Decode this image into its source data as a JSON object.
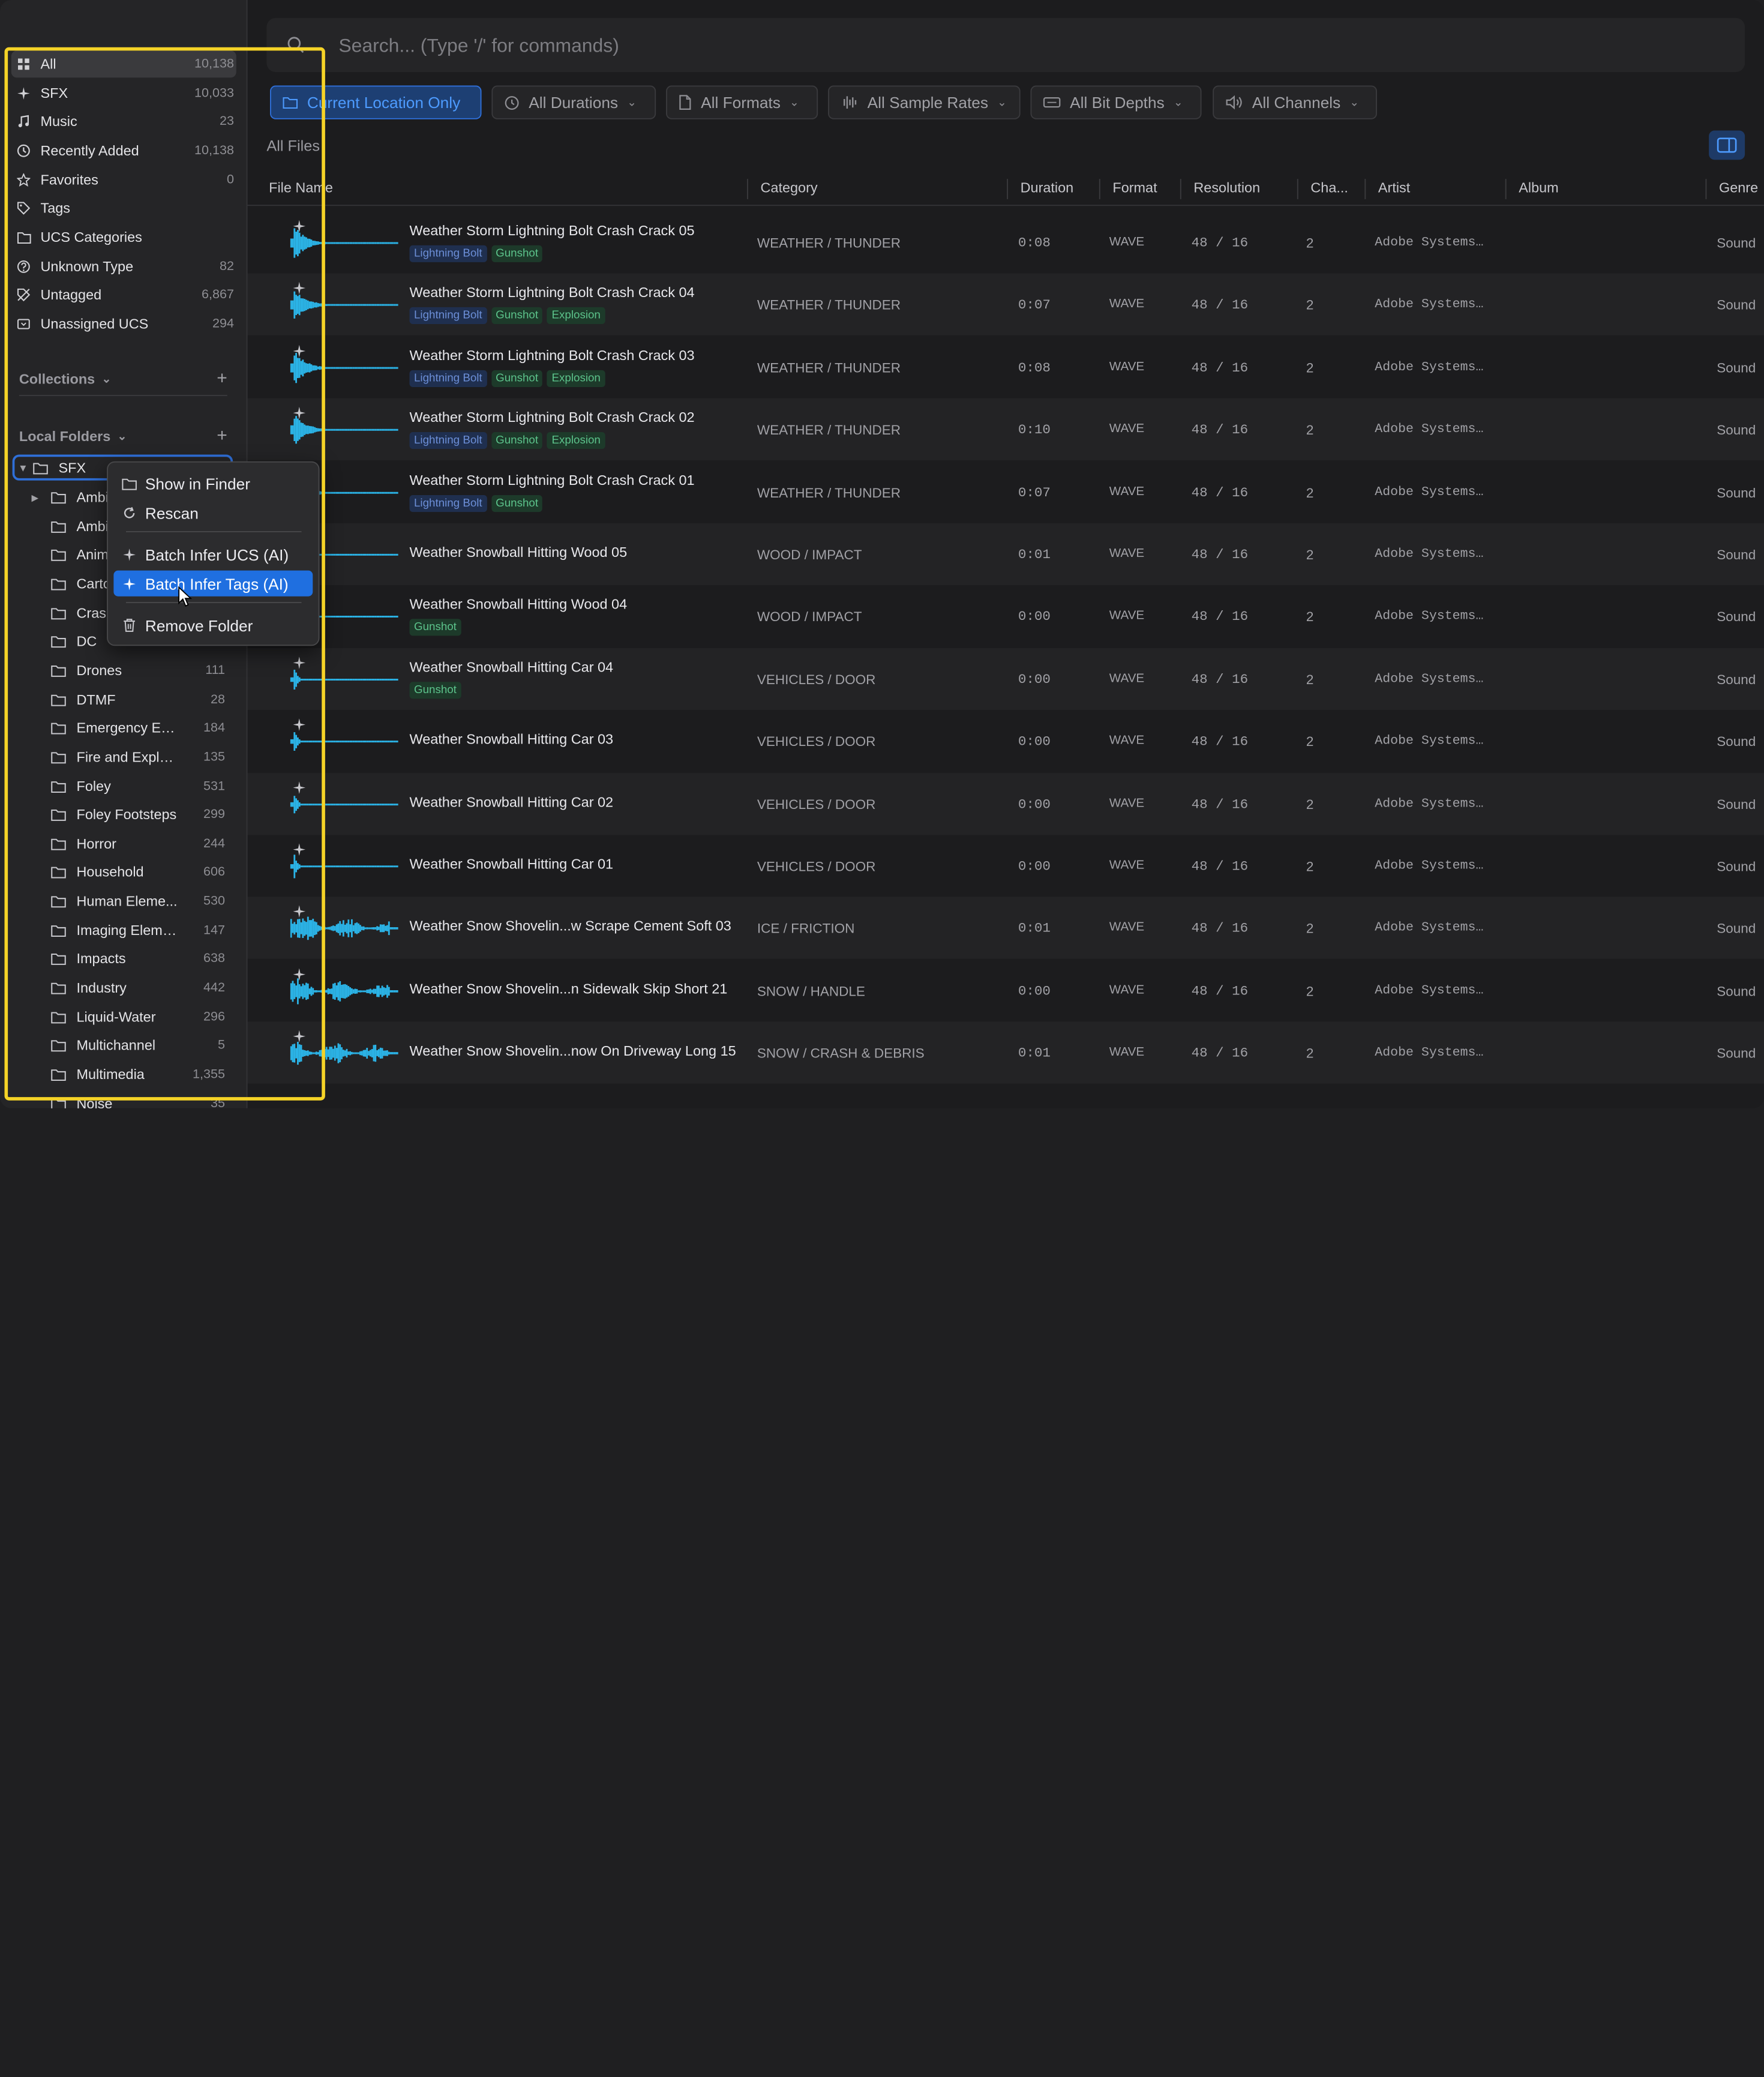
{
  "sidebar": {
    "nav": [
      {
        "label": "All",
        "count": "10,138",
        "icon": "grid-icon"
      },
      {
        "label": "SFX",
        "count": "10,033",
        "icon": "sparkle-icon"
      },
      {
        "label": "Music",
        "count": "23",
        "icon": "music-note-icon"
      },
      {
        "label": "Recently Added",
        "count": "10,138",
        "icon": "clock-icon"
      },
      {
        "label": "Favorites",
        "count": "0",
        "icon": "star-icon"
      },
      {
        "label": "Tags",
        "count": "",
        "icon": "tag-icon"
      },
      {
        "label": "UCS Categories",
        "count": "",
        "icon": "folder-tree-icon"
      },
      {
        "label": "Unknown Type",
        "count": "82",
        "icon": "question-icon"
      },
      {
        "label": "Untagged",
        "count": "6,867",
        "icon": "tag-off-icon"
      },
      {
        "label": "Unassigned UCS",
        "count": "294",
        "icon": "box-icon"
      }
    ],
    "collections_label": "Collections",
    "local_folders_label": "Local Folders",
    "root_folder": "SFX",
    "folders": [
      {
        "label": "Ambi",
        "count": ""
      },
      {
        "label": "Ambi",
        "count": ""
      },
      {
        "label": "Anim",
        "count": ""
      },
      {
        "label": "Carto",
        "count": ""
      },
      {
        "label": "Cras",
        "count": ""
      },
      {
        "label": "DC",
        "count": ""
      },
      {
        "label": "Drones",
        "count": "111"
      },
      {
        "label": "DTMF",
        "count": "28"
      },
      {
        "label": "Emergency Eff...",
        "count": "184"
      },
      {
        "label": "Fire and Explo...",
        "count": "135"
      },
      {
        "label": "Foley",
        "count": "531"
      },
      {
        "label": "Foley Footsteps",
        "count": "299"
      },
      {
        "label": "Horror",
        "count": "244"
      },
      {
        "label": "Household",
        "count": "606"
      },
      {
        "label": "Human Eleme...",
        "count": "530"
      },
      {
        "label": "Imaging Eleme...",
        "count": "147"
      },
      {
        "label": "Impacts",
        "count": "638"
      },
      {
        "label": "Industry",
        "count": "442"
      },
      {
        "label": "Liquid-Water",
        "count": "296"
      },
      {
        "label": "Multichannel",
        "count": "5"
      },
      {
        "label": "Multimedia",
        "count": "1,355"
      },
      {
        "label": "Noise",
        "count": "35"
      }
    ]
  },
  "search": {
    "placeholder": "Search... (Type '/' for commands)"
  },
  "filters": [
    {
      "label": "Current Location Only",
      "icon": "folder-icon"
    },
    {
      "label": "All Durations",
      "icon": "timer-icon"
    },
    {
      "label": "All Formats",
      "icon": "file-icon"
    },
    {
      "label": "All Sample Rates",
      "icon": "waveform-icon"
    },
    {
      "label": "All Bit Depths",
      "icon": "chip-icon"
    },
    {
      "label": "All Channels",
      "icon": "speaker-icon"
    }
  ],
  "list_title": "All Files",
  "columns": [
    "File Name",
    "Category",
    "Duration",
    "Format",
    "Resolution",
    "Cha...",
    "Artist",
    "Album",
    "Genre"
  ],
  "rows": [
    {
      "name": "Weather Storm Lightning Bolt Crash Crack 05",
      "tags": [
        "Lightning Bolt",
        "Gunshot"
      ],
      "category": "WEATHER / THUNDER",
      "duration": "0:08",
      "format": "WAVE",
      "resolution": "48 / 16",
      "channels": "2",
      "artist": "Adobe Systems…",
      "genre": "Sound",
      "wave": "burst"
    },
    {
      "name": "Weather Storm Lightning Bolt Crash Crack 04",
      "tags": [
        "Lightning Bolt",
        "Gunshot",
        "Explosion"
      ],
      "category": "WEATHER / THUNDER",
      "duration": "0:07",
      "format": "WAVE",
      "resolution": "48 / 16",
      "channels": "2",
      "artist": "Adobe Systems…",
      "genre": "Sound",
      "wave": "burst"
    },
    {
      "name": "Weather Storm Lightning Bolt Crash Crack 03",
      "tags": [
        "Lightning Bolt",
        "Gunshot",
        "Explosion"
      ],
      "category": "WEATHER / THUNDER",
      "duration": "0:08",
      "format": "WAVE",
      "resolution": "48 / 16",
      "channels": "2",
      "artist": "Adobe Systems…",
      "genre": "Sound",
      "wave": "burst"
    },
    {
      "name": "Weather Storm Lightning Bolt Crash Crack 02",
      "tags": [
        "Lightning Bolt",
        "Gunshot",
        "Explosion"
      ],
      "category": "WEATHER / THUNDER",
      "duration": "0:10",
      "format": "WAVE",
      "resolution": "48 / 16",
      "channels": "2",
      "artist": "Adobe Systems…",
      "genre": "Sound",
      "wave": "burst"
    },
    {
      "name": "Weather Storm Lightning Bolt Crash Crack 01",
      "tags": [
        "Lightning Bolt",
        "Gunshot"
      ],
      "category": "WEATHER / THUNDER",
      "duration": "0:07",
      "format": "WAVE",
      "resolution": "48 / 16",
      "channels": "2",
      "artist": "Adobe Systems…",
      "genre": "Sound",
      "wave": "burst"
    },
    {
      "name": "Weather Snowball Hitting Wood 05",
      "tags": [],
      "category": "WOOD / IMPACT",
      "duration": "0:01",
      "format": "WAVE",
      "resolution": "48 / 16",
      "channels": "2",
      "artist": "Adobe Systems…",
      "genre": "Sound",
      "wave": "spike"
    },
    {
      "name": "Weather Snowball Hitting Wood 04",
      "tags": [
        "Gunshot"
      ],
      "category": "WOOD / IMPACT",
      "duration": "0:00",
      "format": "WAVE",
      "resolution": "48 / 16",
      "channels": "2",
      "artist": "Adobe Systems…",
      "genre": "Sound",
      "wave": "spike"
    },
    {
      "name": "Weather Snowball Hitting Car 04",
      "tags": [
        "Gunshot"
      ],
      "category": "VEHICLES / DOOR",
      "duration": "0:00",
      "format": "WAVE",
      "resolution": "48 / 16",
      "channels": "2",
      "artist": "Adobe Systems…",
      "genre": "Sound",
      "wave": "spike"
    },
    {
      "name": "Weather Snowball Hitting Car 03",
      "tags": [],
      "category": "VEHICLES / DOOR",
      "duration": "0:00",
      "format": "WAVE",
      "resolution": "48 / 16",
      "channels": "2",
      "artist": "Adobe Systems…",
      "genre": "Sound",
      "wave": "spike"
    },
    {
      "name": "Weather Snowball Hitting Car 02",
      "tags": [],
      "category": "VEHICLES / DOOR",
      "duration": "0:00",
      "format": "WAVE",
      "resolution": "48 / 16",
      "channels": "2",
      "artist": "Adobe Systems…",
      "genre": "Sound",
      "wave": "spike"
    },
    {
      "name": "Weather Snowball Hitting Car 01",
      "tags": [],
      "category": "VEHICLES / DOOR",
      "duration": "0:00",
      "format": "WAVE",
      "resolution": "48 / 16",
      "channels": "2",
      "artist": "Adobe Systems…",
      "genre": "Sound",
      "wave": "spike"
    },
    {
      "name": "Weather Snow Shovelin...w Scrape Cement Soft 03",
      "tags": [],
      "category": "ICE / FRICTION",
      "duration": "0:01",
      "format": "WAVE",
      "resolution": "48 / 16",
      "channels": "2",
      "artist": "Adobe Systems…",
      "genre": "Sound",
      "wave": "dense"
    },
    {
      "name": "Weather Snow Shovelin...n Sidewalk Skip Short 21",
      "tags": [],
      "category": "SNOW / HANDLE",
      "duration": "0:00",
      "format": "WAVE",
      "resolution": "48 / 16",
      "channels": "2",
      "artist": "Adobe Systems…",
      "genre": "Sound",
      "wave": "dense"
    },
    {
      "name": "Weather Snow Shovelin...now On Driveway Long 15",
      "tags": [],
      "category": "SNOW / CRASH & DEBRIS",
      "duration": "0:01",
      "format": "WAVE",
      "resolution": "48 / 16",
      "channels": "2",
      "artist": "Adobe Systems…",
      "genre": "Sound",
      "wave": "dense"
    }
  ],
  "context_menu": {
    "items": [
      {
        "label": "Show in Finder",
        "icon": "folder-icon"
      },
      {
        "label": "Rescan",
        "icon": "refresh-icon"
      },
      {
        "label": "Batch Infer UCS (AI)",
        "icon": "sparkle-icon"
      },
      {
        "label": "Batch Infer Tags (AI)",
        "icon": "sparkle-icon"
      },
      {
        "label": "Remove Folder",
        "icon": "trash-icon"
      }
    ],
    "selected": "Batch Infer Tags (AI)"
  },
  "colors": {
    "accent": "#1f6fe0",
    "waveform": "#2bb3e6",
    "highlight": "#f5d327",
    "tag_blue": "#6c8fd8",
    "tag_green": "#5cc38b"
  }
}
